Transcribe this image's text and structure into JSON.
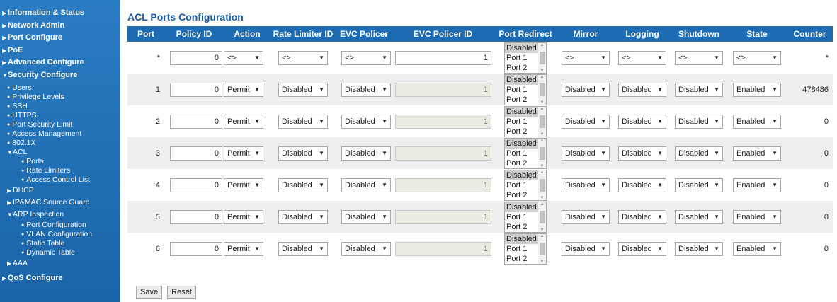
{
  "sidebar": {
    "info_status": "Information & Status",
    "network_admin": "Network Admin",
    "port_configure": "Port Configure",
    "poe": "PoE",
    "advanced_configure": "Advanced Configure",
    "security_configure": "Security Configure",
    "users": "Users",
    "privilege_levels": "Privilege Levels",
    "ssh": "SSH",
    "https": "HTTPS",
    "port_security_limit": "Port Security Limit",
    "access_management": "Access Management",
    "dot1x": "802.1X",
    "acl": "ACL",
    "acl_ports": "Ports",
    "acl_rate_limiters": "Rate Limiters",
    "acl_access_control_list": "Access Control List",
    "dhcp": "DHCP",
    "ip_mac_source_guard": "IP&MAC Source Guard",
    "arp_inspection": "ARP Inspection",
    "arp_port_configuration": "Port Configuration",
    "arp_vlan_configuration": "VLAN Configuration",
    "arp_static_table": "Static Table",
    "arp_dynamic_table": "Dynamic Table",
    "aaa": "AAA",
    "qos_configure": "QoS Configure"
  },
  "page_title": "ACL Ports Configuration",
  "columns": {
    "port": "Port",
    "policy_id": "Policy ID",
    "action": "Action",
    "rate_limiter_id": "Rate Limiter ID",
    "evc_policer": "EVC Policer",
    "evc_policer_id": "EVC Policer ID",
    "port_redirect": "Port Redirect",
    "mirror": "Mirror",
    "logging": "Logging",
    "shutdown": "Shutdown",
    "state": "State",
    "counter": "Counter"
  },
  "redirect_options": [
    "Disabled",
    "Port 1",
    "Port 2"
  ],
  "rows": {
    "all": {
      "port": "*",
      "policy_id": "0",
      "action": "<>",
      "rate_limiter_id": "<>",
      "evc_policer": "<>",
      "evc_policer_id": "1",
      "mirror": "<>",
      "logging": "<>",
      "shutdown": "<>",
      "state": "<>",
      "counter": "*"
    },
    "p1": {
      "port": "1",
      "policy_id": "0",
      "action": "Permit",
      "rate_limiter_id": "Disabled",
      "evc_policer": "Disabled",
      "evc_policer_id": "1",
      "mirror": "Disabled",
      "logging": "Disabled",
      "shutdown": "Disabled",
      "state": "Enabled",
      "counter": "478486"
    },
    "p2": {
      "port": "2",
      "policy_id": "0",
      "action": "Permit",
      "rate_limiter_id": "Disabled",
      "evc_policer": "Disabled",
      "evc_policer_id": "1",
      "mirror": "Disabled",
      "logging": "Disabled",
      "shutdown": "Disabled",
      "state": "Enabled",
      "counter": "0"
    },
    "p3": {
      "port": "3",
      "policy_id": "0",
      "action": "Permit",
      "rate_limiter_id": "Disabled",
      "evc_policer": "Disabled",
      "evc_policer_id": "1",
      "mirror": "Disabled",
      "logging": "Disabled",
      "shutdown": "Disabled",
      "state": "Enabled",
      "counter": "0"
    },
    "p4": {
      "port": "4",
      "policy_id": "0",
      "action": "Permit",
      "rate_limiter_id": "Disabled",
      "evc_policer": "Disabled",
      "evc_policer_id": "1",
      "mirror": "Disabled",
      "logging": "Disabled",
      "shutdown": "Disabled",
      "state": "Enabled",
      "counter": "0"
    },
    "p5": {
      "port": "5",
      "policy_id": "0",
      "action": "Permit",
      "rate_limiter_id": "Disabled",
      "evc_policer": "Disabled",
      "evc_policer_id": "1",
      "mirror": "Disabled",
      "logging": "Disabled",
      "shutdown": "Disabled",
      "state": "Enabled",
      "counter": "0"
    },
    "p6": {
      "port": "6",
      "policy_id": "0",
      "action": "Permit",
      "rate_limiter_id": "Disabled",
      "evc_policer": "Disabled",
      "evc_policer_id": "1",
      "mirror": "Disabled",
      "logging": "Disabled",
      "shutdown": "Disabled",
      "state": "Enabled",
      "counter": "0"
    }
  },
  "buttons": {
    "save": "Save",
    "reset": "Reset"
  },
  "icons": {
    "collapsed": "triangle-right-icon",
    "expanded": "triangle-down-icon",
    "bullet": "bullet-icon",
    "dropdown": "caret-down-icon"
  },
  "colors": {
    "sidebar_bg": "#1f6fb5",
    "header_bg": "#1d6bb3",
    "title": "#1c5aa0",
    "row_alt": "#eeeeee"
  }
}
